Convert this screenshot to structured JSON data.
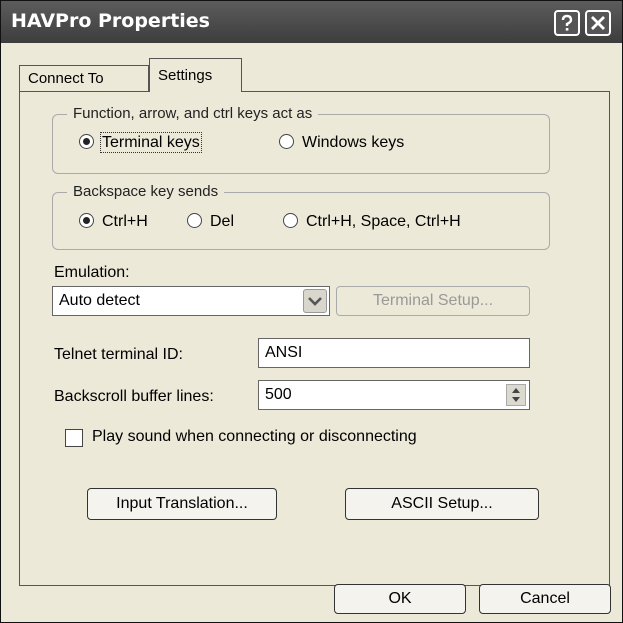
{
  "window": {
    "title": "HAVPro Properties"
  },
  "tabs": [
    {
      "label": "Connect To"
    },
    {
      "label": "Settings"
    }
  ],
  "keys_group": {
    "legend": "Function, arrow, and ctrl keys act as",
    "options": [
      {
        "label": "Terminal keys",
        "selected": true
      },
      {
        "label": "Windows keys",
        "selected": false
      }
    ]
  },
  "backspace_group": {
    "legend": "Backspace key sends",
    "options": [
      {
        "label": "Ctrl+H",
        "selected": true
      },
      {
        "label": "Del",
        "selected": false
      },
      {
        "label": "Ctrl+H, Space, Ctrl+H",
        "selected": false
      }
    ]
  },
  "emulation": {
    "label": "Emulation:",
    "value": "Auto detect",
    "setup_button": "Terminal Setup..."
  },
  "telnet": {
    "label": "Telnet terminal ID:",
    "value": "ANSI"
  },
  "backscroll": {
    "label": "Backscroll buffer lines:",
    "value": "500"
  },
  "sound": {
    "label": "Play sound when connecting or disconnecting",
    "checked": false
  },
  "buttons": {
    "input_translation": "Input Translation...",
    "ascii_setup": "ASCII Setup...",
    "ok": "OK",
    "cancel": "Cancel"
  }
}
